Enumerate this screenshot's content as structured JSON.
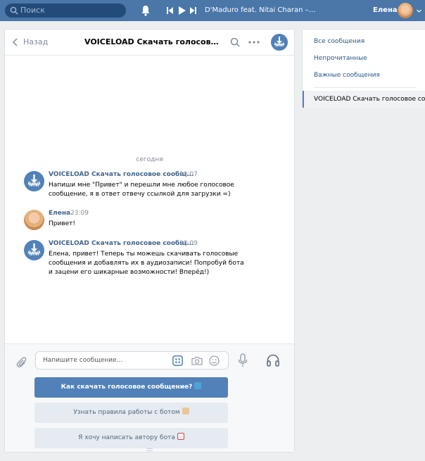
{
  "topbar": {
    "search_placeholder": "Поиск",
    "track": "D'Maduro feat. Nitai Charan – Seth I...",
    "user_name": "Елена"
  },
  "chat": {
    "back_label": "Назад",
    "title": "VOICELOAD Скачать голосовое сообщение",
    "date_separator": "сегодня",
    "messages": [
      {
        "author": "VOICELOAD Скачать голосовое сообщ...",
        "time": "23:07",
        "text": "Напиши мне \"Привет\" и перешли мне любое голосовое сообщение, я в ответ отвечу ссылкой для загрузки =)"
      },
      {
        "author": "Елена",
        "time": "23:09",
        "text": "Привет!"
      },
      {
        "author": "VOICELOAD Скачать голосовое сообщ...",
        "time": "23:09",
        "text": "Елена, привет! Теперь ты можешь скачивать голосовые сообщения и добавлять их в аудиозаписи! Попробуй бота и зацени его шикарные возможности! Вперёд!)"
      }
    ]
  },
  "composer": {
    "placeholder": "Напишите сообщение...",
    "buttons": [
      {
        "label": "Как скачать голосовое сообщение?"
      },
      {
        "label": "Узнать правила работы с ботом"
      },
      {
        "label": "Я хочу написать автору бота"
      }
    ]
  },
  "sidebar": {
    "items": [
      {
        "label": "Все сообщения"
      },
      {
        "label": "Непрочитанные"
      },
      {
        "label": "Важные сообщения"
      },
      {
        "label": "VOICELOAD Скачать голосовое сообщение"
      }
    ]
  },
  "colors": {
    "topbar": "#4a76a8",
    "accent": "#5181b8",
    "link": "#2a5885",
    "author": "#42648b"
  },
  "icons": [
    "search-icon",
    "bell-icon",
    "prev-icon",
    "play-icon",
    "next-icon",
    "chevron-down-icon",
    "back-icon",
    "more-icon",
    "attach-icon",
    "keyboard-icon",
    "camera-icon",
    "emoji-icon",
    "mic-icon",
    "headphones-icon"
  ]
}
